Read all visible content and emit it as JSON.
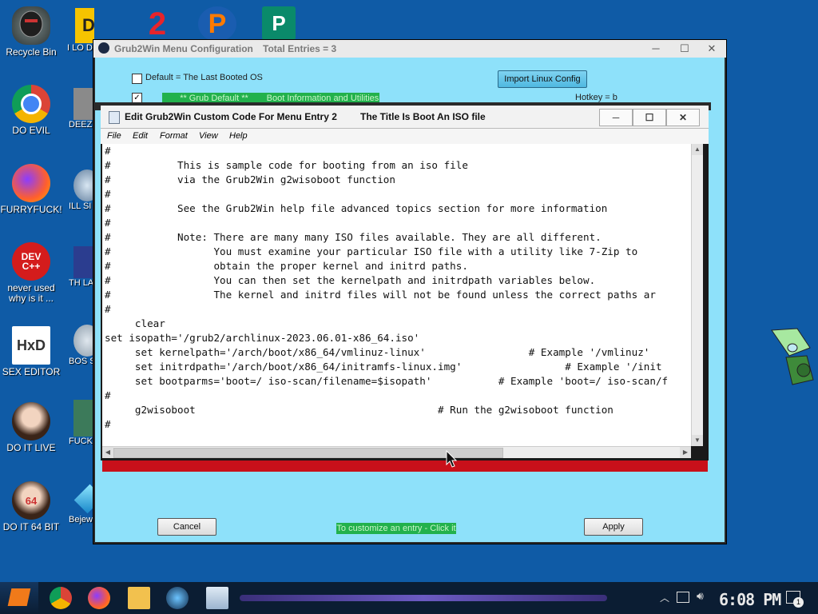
{
  "desktop": {
    "icons": [
      {
        "label": "Recycle Bin"
      },
      {
        "label": "DO EVIL"
      },
      {
        "label": "FURRYFUCK!"
      },
      {
        "label": "never used why is it ..."
      },
      {
        "label": "SEX EDITOR"
      },
      {
        "label": "DO IT LIVE"
      },
      {
        "label": "DO IT 64 BIT"
      }
    ],
    "partial_labels": [
      "I LO DETECT",
      "DEEZ HAH C",
      "ILL SI YO",
      "TH LANGUA",
      "BOS SIMUL",
      "FUCK EL",
      "Bejew Del"
    ],
    "top_row_glyphs": [
      "De",
      "2",
      "P",
      "P"
    ],
    "dev_icon_text": "DEV C++"
  },
  "grub_window": {
    "title": "Grub2Win Menu Configuration",
    "total_entries": "Total Entries = 3",
    "default_checkbox_label": "Default = The Last Booted OS",
    "import_button": "Import Linux Config",
    "grub_default_label": "** Grub Default **",
    "boot_info_label": "Boot Information and Utilities",
    "hotkey": "Hotkey = b",
    "cancel_button": "Cancel",
    "customize_hint": "To customize an entry - Click it",
    "apply_button": "Apply"
  },
  "editor_window": {
    "title_left": "Edit Grub2Win Custom Code For Menu Entry 2",
    "title_right": "The Title Is Boot An ISO file",
    "menu": [
      "File",
      "Edit",
      "Format",
      "View",
      "Help"
    ],
    "code_lines": [
      "#",
      "#           This is sample code for booting from an iso file",
      "#           via the Grub2Win g2wisoboot function",
      "#",
      "#           See the Grub2Win help file advanced topics section for more information",
      "#",
      "#           Note: There are many many ISO files available. They are all different.",
      "#                 You must examine your particular ISO file with a utility like 7-Zip to",
      "#                 obtain the proper kernel and initrd paths.",
      "#                 You can then set the kernelpath and initrdpath variables below.",
      "#                 The kernel and initrd files will not be found unless the correct paths ar",
      "#",
      "     clear",
      "set isopath='/grub2/archlinux-2023.06.01-x86_64.iso'",
      "     set kernelpath='/arch/boot/x86_64/vmlinuz-linux'                 # Example '/vmlinuz'",
      "     set initrdpath='/arch/boot/x86_64/initramfs-linux.img'                 # Example '/init",
      "     set bootparms='boot=/ iso-scan/filename=$isopath'           # Example 'boot=/ iso-scan/f",
      "#",
      "     g2wisoboot                                        # Run the g2wisoboot function",
      "#"
    ]
  },
  "taskbar": {
    "clock": "6:08 PM",
    "notification_count": "1"
  }
}
